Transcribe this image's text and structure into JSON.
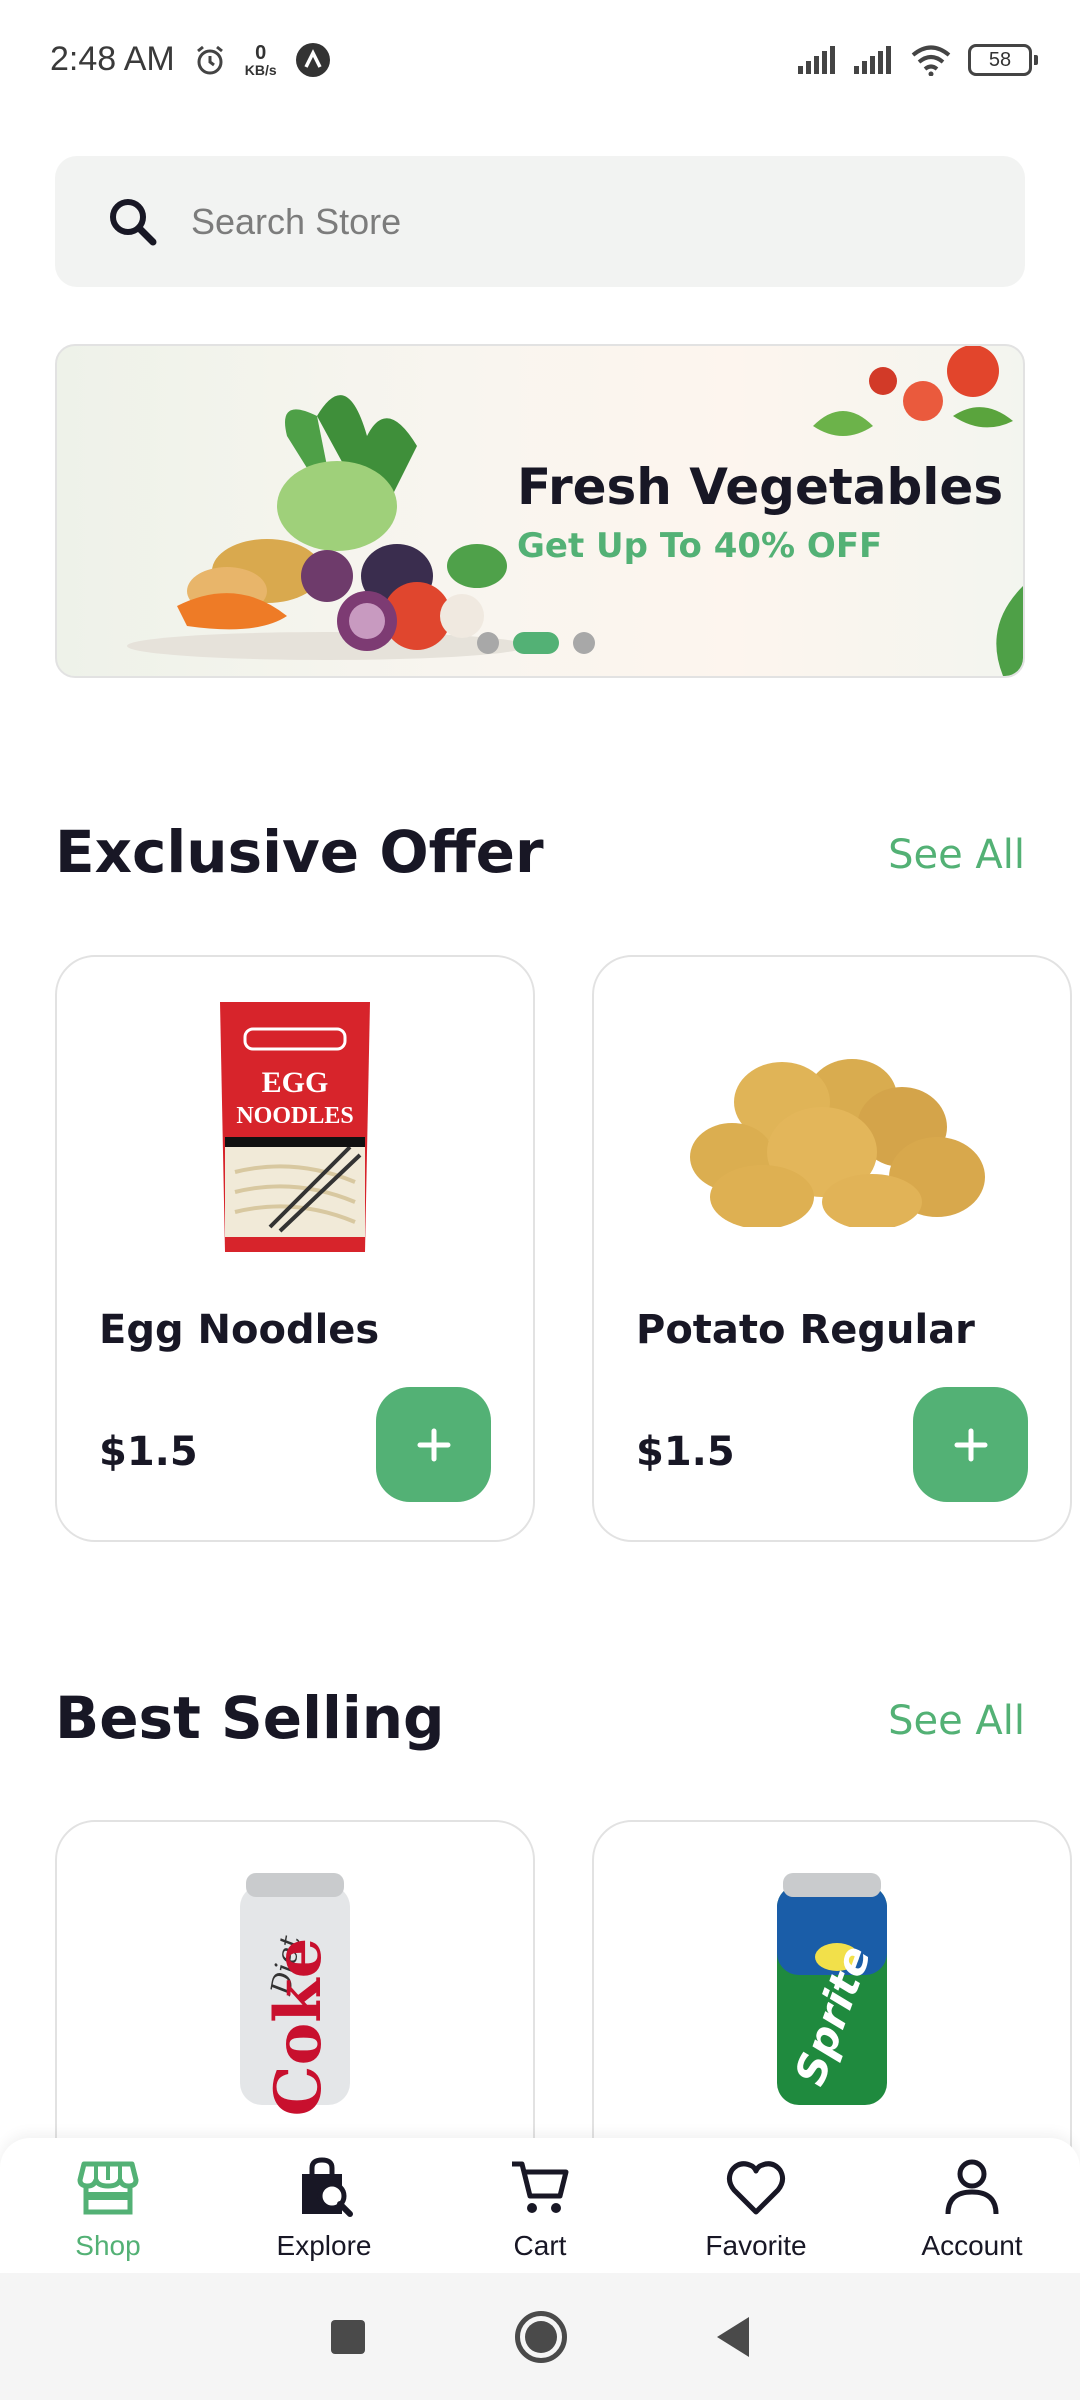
{
  "status_bar": {
    "time": "2:48 AM",
    "net_speed_value": "0",
    "net_speed_unit": "KB/s",
    "battery": "58"
  },
  "search": {
    "placeholder": "Search Store"
  },
  "banner": {
    "title": "Fresh Vegetables",
    "subtitle": "Get Up To 40% OFF",
    "active_slide": 1,
    "slide_count": 3
  },
  "exclusive_offer": {
    "title": "Exclusive Offer",
    "see_all": "See All",
    "products": [
      {
        "name": "Egg Noodles",
        "price": "$1.5",
        "image": "egg-noodles-image"
      },
      {
        "name": "Potato Regular",
        "price": "$1.5",
        "image": "potato-image"
      }
    ]
  },
  "best_selling": {
    "title": "Best Selling",
    "see_all": "See All",
    "products": [
      {
        "image": "diet-coke-image"
      },
      {
        "image": "sprite-image"
      }
    ]
  },
  "bottom_nav": {
    "items": [
      {
        "label": "Shop",
        "icon": "store-icon",
        "active": true
      },
      {
        "label": "Explore",
        "icon": "shopping-bag-search-icon",
        "active": false
      },
      {
        "label": "Cart",
        "icon": "cart-icon",
        "active": false
      },
      {
        "label": "Favorite",
        "icon": "heart-icon",
        "active": false
      },
      {
        "label": "Account",
        "icon": "person-icon",
        "active": false
      }
    ]
  },
  "colors": {
    "accent": "#53B175",
    "text": "#181725",
    "muted": "#7C7C7C",
    "search_bg": "#F2F3F2"
  }
}
